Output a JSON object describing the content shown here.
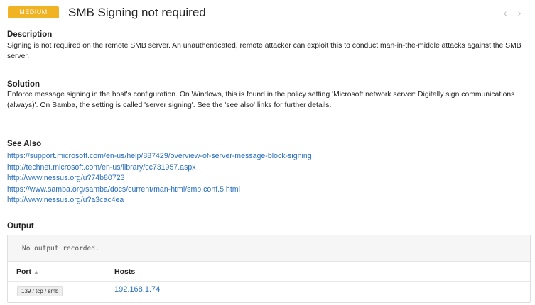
{
  "header": {
    "severity": "MEDIUM",
    "title": "SMB Signing not required",
    "prev_icon": "‹",
    "next_icon": "›"
  },
  "description": {
    "heading": "Description",
    "text": "Signing is not required on the remote SMB server. An unauthenticated, remote attacker can exploit this to conduct man-in-the-middle attacks against the SMB server."
  },
  "solution": {
    "heading": "Solution",
    "text": "Enforce message signing in the host's configuration. On Windows, this is found in the policy setting 'Microsoft network server: Digitally sign communications (always)'. On Samba, the setting is called 'server signing'. See the 'see also' links for further details."
  },
  "see_also": {
    "heading": "See Also",
    "links": [
      "https://support.microsoft.com/en-us/help/887429/overview-of-server-message-block-signing",
      "http://technet.microsoft.com/en-us/library/cc731957.aspx",
      "http://www.nessus.org/u?74b80723",
      "https://www.samba.org/samba/docs/current/man-html/smb.conf.5.html",
      "http://www.nessus.org/u?a3cac4ea"
    ]
  },
  "output": {
    "heading": "Output",
    "no_output_text": "No output recorded.",
    "columns": {
      "port": "Port",
      "hosts": "Hosts"
    },
    "sort_icon": "▲",
    "rows": [
      {
        "port": "139 / tcp / smb",
        "host": "192.168.1.74"
      }
    ]
  },
  "colors": {
    "severity_medium": "#f0b323",
    "link": "#2a6fbe"
  }
}
